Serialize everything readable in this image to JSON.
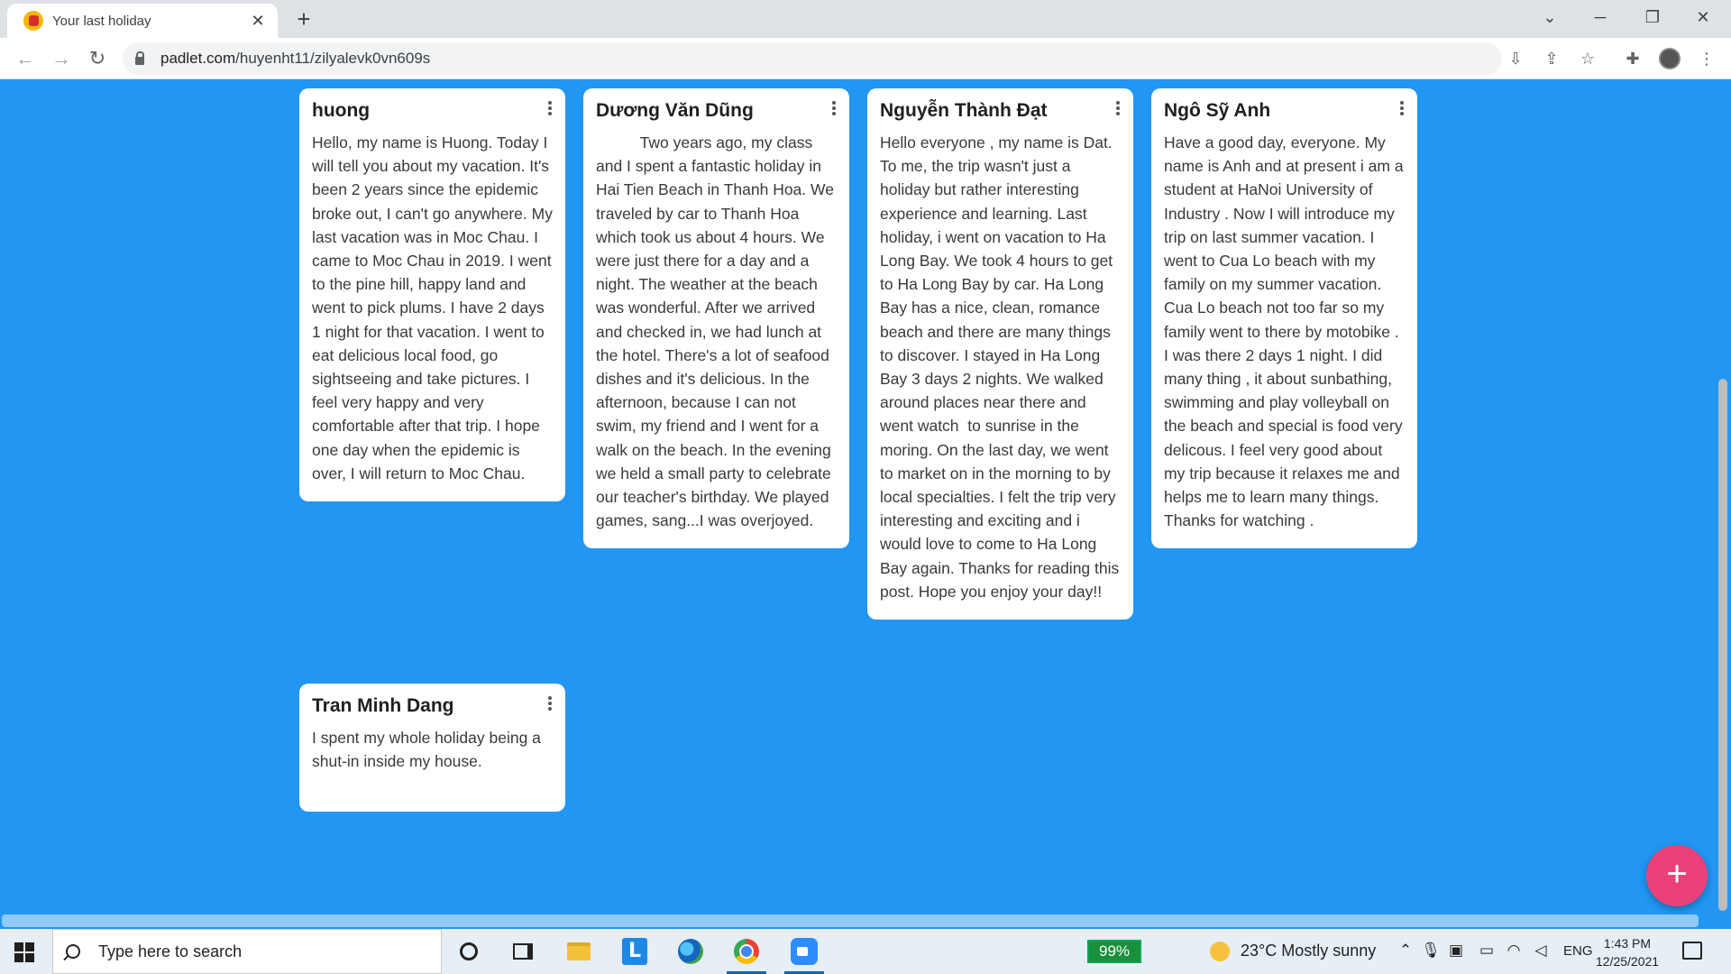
{
  "browser": {
    "tab_title": "Your last holiday",
    "url_host": "padlet.com",
    "url_path": "/huyenht11/zilyalevk0vn609s"
  },
  "cards": [
    {
      "title": "huong",
      "body": "Hello, my name is Huong. Today I will tell you about my vacation. It's been 2 years since the epidemic broke out, I can't go anywhere. My last vacation was in Moc Chau. I came to Moc Chau in 2019. I went to the pine hill, happy land and went to pick plums. I have 2 days 1 night for that vacation. I went to eat delicious local food, go sightseeing and take pictures. I feel very happy and very comfortable after that trip. I hope one day when the epidemic is over, I will return to Moc Chau."
    },
    {
      "title": "Dương Văn Dũng",
      "body": "          Two years ago, my class and I spent a fantastic holiday in Hai Tien Beach in Thanh Hoa. We traveled by car to Thanh Hoa which took us about 4 hours. We were just there for a day and a night. The weather at the beach was wonderful. After we arrived and checked in, we had lunch at the hotel. There's a lot of seafood dishes and it's delicious. In the afternoon, because I can not swim, my friend and I went for a walk on the beach. In the evening we held a small party to celebrate our teacher's birthday. We played games, sang...I was overjoyed."
    },
    {
      "title": "Nguyễn Thành Đạt",
      "body": "Hello everyone , my name is Dat. To me, the trip wasn't just a holiday but rather interesting experience and learning. Last holiday, i went on vacation to Ha Long Bay. We took 4 hours to get to Ha Long Bay by car. Ha Long Bay has a nice, clean, romance beach and there are many things to discover. I stayed in Ha Long Bay 3 days 2 nights. We walked around places near there and went watch  to sunrise in the moring. On the last day, we went to market on in the morning to by local specialties. I felt the trip very interesting and exciting and i would love to come to Ha Long Bay again. Thanks for reading this post. Hope you enjoy your day!!"
    },
    {
      "title": "Ngô Sỹ Anh",
      "body": "Have a good day, everyone. My name is Anh and at present i am a student at HaNoi University of Industry . Now I will introduce my trip on last summer vacation. I went to Cua Lo beach with my family on my summer vacation. Cua Lo beach not too far so my family went to there by motobike . I was there 2 days 1 night. I did many thing , it about sunbathing, swimming and play volleyball on the beach and special is food very delicous. I feel very good about my trip because it relaxes me and helps me to learn many things. Thanks for watching ."
    },
    {
      "title": "Tran Minh Dang",
      "body": "I spent my whole holiday being a shut-in inside my house."
    }
  ],
  "fab_label": "+",
  "taskbar": {
    "search_placeholder": "Type here to search",
    "l_app_label": "L",
    "battery": "99%",
    "weather": "23°C  Mostly sunny",
    "language": "ENG",
    "time": "1:43 PM",
    "date": "12/25/2021"
  },
  "colors": {
    "background": "#2196f3",
    "card": "#ffffff",
    "fab": "#ec407a"
  }
}
